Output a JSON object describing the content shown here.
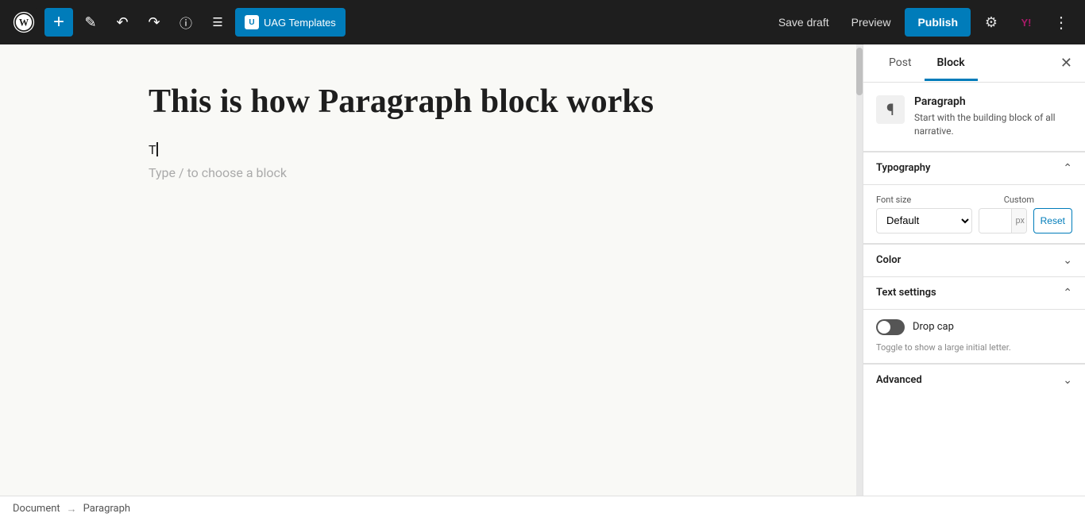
{
  "toolbar": {
    "add_label": "+",
    "save_draft_label": "Save draft",
    "preview_label": "Preview",
    "publish_label": "Publish",
    "uag_label": "UAG Templates"
  },
  "editor": {
    "post_title": "This is how Paragraph block works",
    "placeholder": "Type / to choose a block"
  },
  "right_panel": {
    "tab_post": "Post",
    "tab_block": "Block",
    "active_tab": "Block",
    "block_name": "Paragraph",
    "block_description": "Start with the building block of all narrative.",
    "typography": {
      "label": "Typography",
      "font_size_label": "Font size",
      "custom_label": "Custom",
      "font_size_option": "Default",
      "px_unit": "px",
      "reset_label": "Reset"
    },
    "color": {
      "label": "Color"
    },
    "text_settings": {
      "label": "Text settings",
      "drop_cap_label": "Drop cap",
      "drop_cap_hint": "Toggle to show a large initial letter."
    },
    "advanced": {
      "label": "Advanced"
    }
  },
  "status_bar": {
    "document_label": "Document",
    "separator": "→",
    "paragraph_label": "Paragraph"
  }
}
